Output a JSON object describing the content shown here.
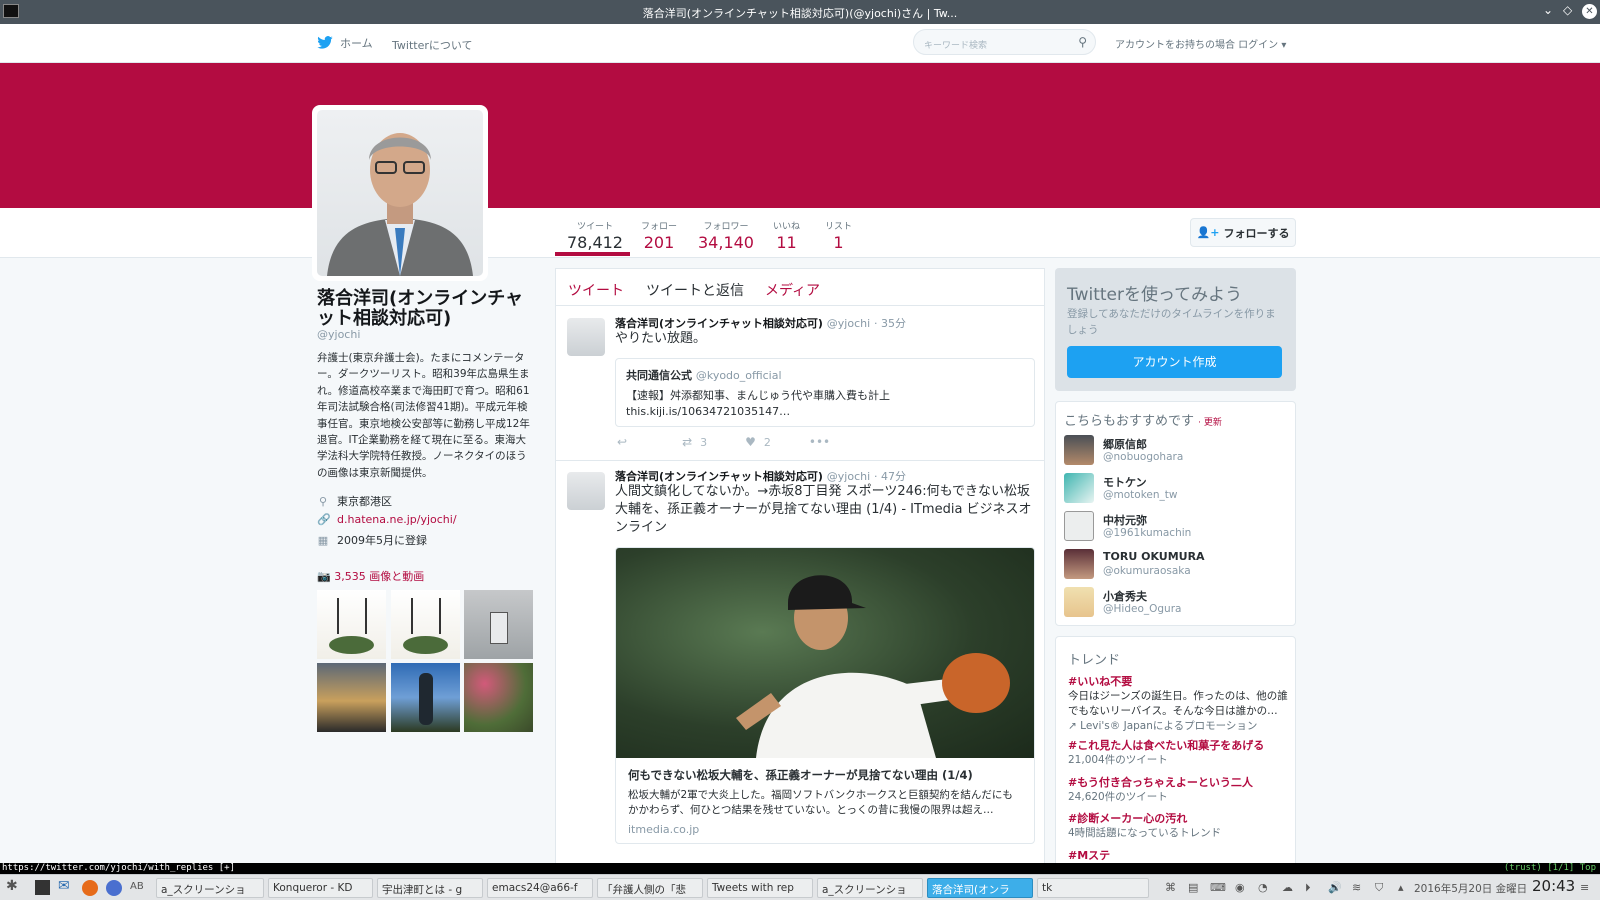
{
  "window": {
    "title": "落合洋司(オンラインチャット相談対応可)(@yjochi)さん | Tw..."
  },
  "nav": {
    "home": "ホーム",
    "about": "Twitterについて",
    "search_placeholder": "キーワード検索",
    "login": "アカウントをお持ちの場合 ログイン"
  },
  "stats": [
    {
      "label": "ツイート",
      "value": "78,412"
    },
    {
      "label": "フォロー",
      "value": "201"
    },
    {
      "label": "フォロワー",
      "value": "34,140"
    },
    {
      "label": "いいね",
      "value": "11"
    },
    {
      "label": "リスト",
      "value": "1"
    }
  ],
  "follow_label": "フォローする",
  "profile": {
    "name": "落合洋司(オンラインチャット相談対応可)",
    "handle": "@yjochi",
    "bio": "弁護士(東京弁護士会)。たまにコメンテーター。ダークツーリスト。昭和39年広島県生まれ。修道高校卒業まで海田町で育つ。昭和61年司法試験合格(司法修習41期)。平成元年検事任官。東京地検公安部等に勤務し平成12年退官。IT企業勤務を経て現在に至る。東海大学法科大学院特任教授。ノーネクタイのほうの画像は東京新聞提供。",
    "location": "東京都港区",
    "url": "d.hatena.ne.jp/yjochi/",
    "joined": "2009年5月に登録",
    "media": "3,535 画像と動画"
  },
  "tabs": [
    "ツイート",
    "ツイートと返信",
    "メディア"
  ],
  "tweets": [
    {
      "name": "落合洋司(オンラインチャット相談対応可)",
      "handle": "@yjochi",
      "time": "35分",
      "text": "やりたい放題。",
      "quote": {
        "name": "共同通信公式",
        "handle": "@kyodo_official",
        "text": "【速報】舛添都知事、まんじゅう代や車購入費も計上",
        "link": "this.kiji.is/10634721035147…"
      },
      "retweets": "3",
      "likes": "2"
    },
    {
      "name": "落合洋司(オンラインチャット相談対応可)",
      "handle": "@yjochi",
      "time": "47分",
      "text": "人間文鎮化してないか。→赤坂8丁目発 スポーツ246:何もできない松坂大輔を、孫正義オーナーが見捨てない理由 (1/4) - ITmedia ビジネスオンライン",
      "card": {
        "title": "何もできない松坂大輔を、孫正義オーナーが見捨てない理由 (1/4)",
        "desc": "松坂大輔が2軍で大炎上した。福岡ソフトバンクホークスと巨額契約を結んだにもかかわらず、何ひとつ結果を残せていない。とっくの昔に我慢の限界は超え…",
        "domain": "itmedia.co.jp"
      }
    }
  ],
  "signup": {
    "title": "Twitterを使ってみよう",
    "desc": "登録してあなただけのタイムラインを作りましょう",
    "button": "アカウント作成"
  },
  "recommend": {
    "title": "こちらもおすすめです",
    "refresh": "· 更新",
    "users": [
      {
        "name": "郷原信郎",
        "handle": "@nobuogohara"
      },
      {
        "name": "モトケン",
        "handle": "@motoken_tw"
      },
      {
        "name": "中村元弥",
        "handle": "@1961kumachin"
      },
      {
        "name": "TORU OKUMURA",
        "handle": "@okumuraosaka"
      },
      {
        "name": "小倉秀夫",
        "handle": "@Hideo_Ogura"
      }
    ]
  },
  "trends": {
    "title": "トレンド",
    "items": [
      {
        "name": "#いいね不要",
        "desc": "今日はジーンズの誕生日。作ったのは、他の誰でもないリーバイス。そんな今日は誰かの…",
        "promo": "Levi's® Japanによるプロモーション"
      },
      {
        "name": "#これ見た人は食べたい和菓子をあげる",
        "desc": "21,004件のツイート"
      },
      {
        "name": "#もう付き合っちゃえよーという二人",
        "desc": "24,620件のツイート"
      },
      {
        "name": "#診断メーカー心の汚れ",
        "desc": "4時間話題になっているトレンド"
      },
      {
        "name": "#Mステ",
        "desc": ""
      }
    ]
  },
  "statusline": {
    "left": "https://twitter.com/yjochi/with_replies [+]",
    "right": "(trust) [1/1] Top"
  },
  "taskbar": {
    "items": [
      "a_スクリーンショ",
      "Konqueror - KD",
      "宇出津町とは - g",
      "emacs24@a66-f",
      "「弁護人側の「悲",
      "Tweets with rep",
      "a_スクリーンショ",
      "落合洋司(オンラ",
      "tk"
    ],
    "date": "2016年5月20日 金曜日",
    "time": "20:43"
  },
  "colors": {
    "accent": "#b30c41",
    "twitter_blue": "#1da1f2"
  }
}
